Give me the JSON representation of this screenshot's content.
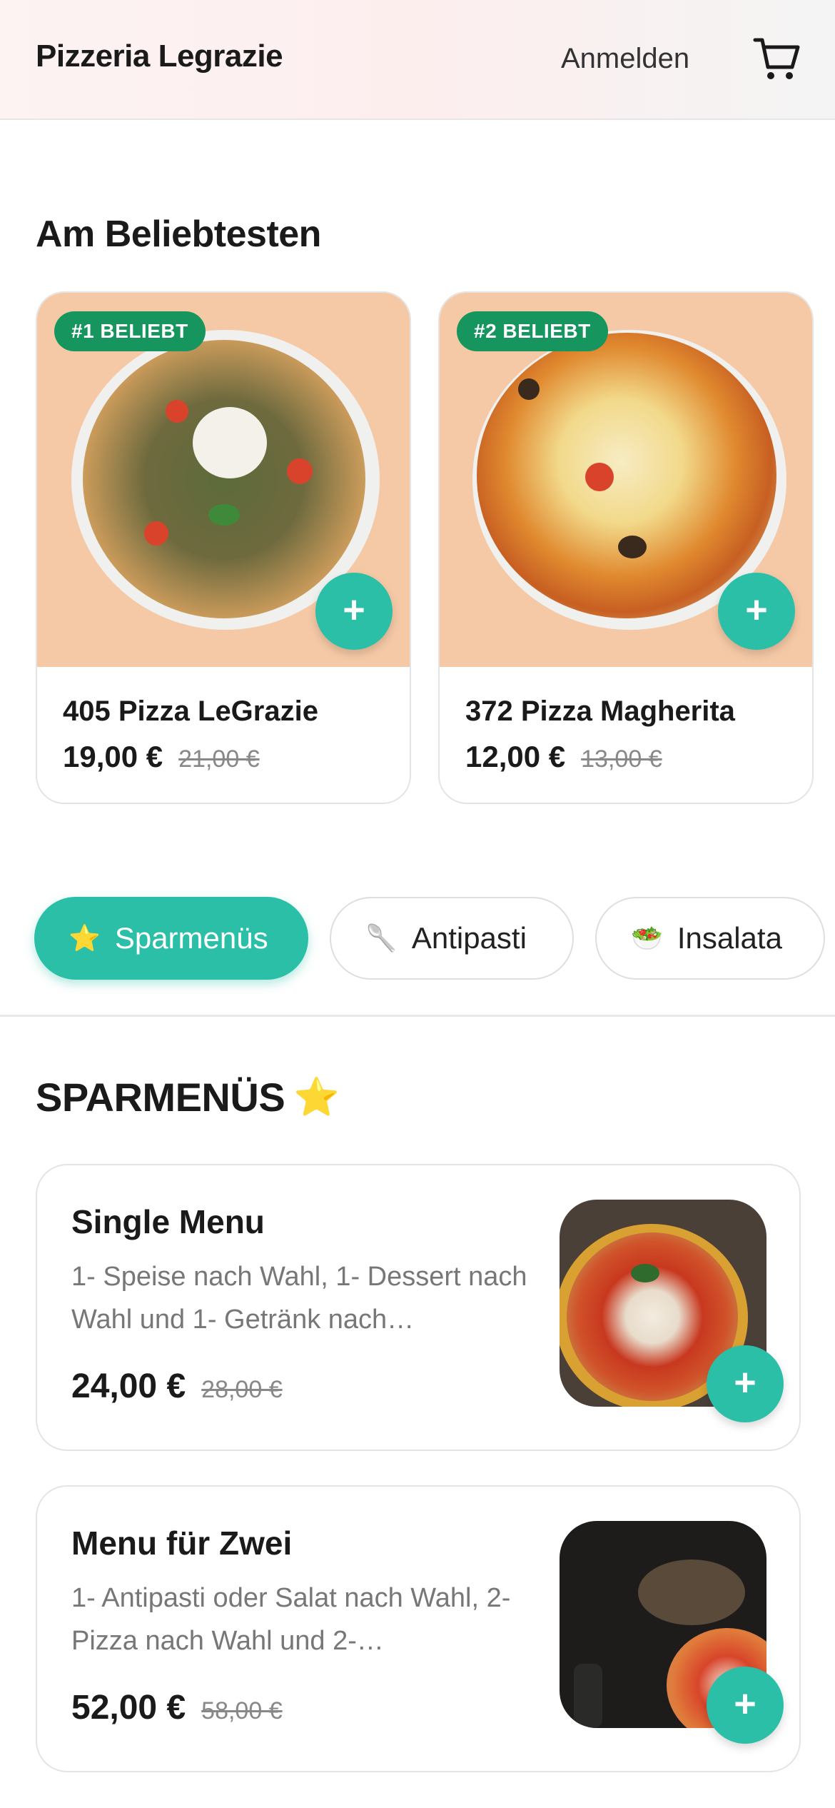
{
  "header": {
    "brand": "Pizzeria Legrazie",
    "login_label": "Anmelden",
    "cart_icon": "cart-icon"
  },
  "popular": {
    "title": "Am Beliebtesten",
    "items": [
      {
        "badge": "#1 BELIEBT",
        "name": "405 Pizza LeGrazie",
        "price": "19,00 €",
        "old_price": "21,00 €",
        "add_label": "+"
      },
      {
        "badge": "#2 BELIEBT",
        "name": "372 Pizza Magherita",
        "price": "12,00 €",
        "old_price": "13,00 €",
        "add_label": "+"
      }
    ]
  },
  "categories": [
    {
      "icon": "⭐",
      "label": "Sparmenüs",
      "active": true
    },
    {
      "icon": "🥄",
      "label": "Antipasti",
      "active": false
    },
    {
      "icon": "🥗",
      "label": "Insalata",
      "active": false
    }
  ],
  "section": {
    "title": "SPARMENÜS",
    "title_icon": "⭐"
  },
  "menus": [
    {
      "name": "Single Menu",
      "description": "1- Speise nach Wahl, 1- Dessert nach Wahl und 1- Getränk nach…",
      "price": "24,00 €",
      "old_price": "28,00 €",
      "add_label": "+"
    },
    {
      "name": "Menu für Zwei",
      "description": "1- Antipasti oder Salat nach Wahl, 2- Pizza nach Wahl und 2-…",
      "price": "52,00 €",
      "old_price": "58,00 €",
      "add_label": "+"
    }
  ],
  "colors": {
    "accent": "#2bbfa8",
    "badge": "#16955e",
    "card_image_bg": "#f5c9a6"
  }
}
